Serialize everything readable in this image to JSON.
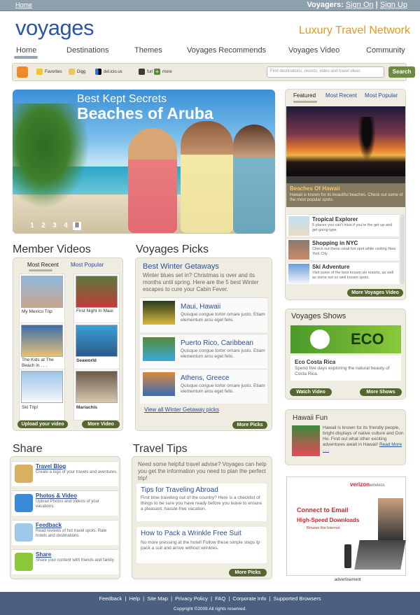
{
  "topbar": {
    "home": "Home",
    "voyagers_label": "Voyagers:",
    "sign_on": "Sign On",
    "sep": " | ",
    "sign_up": "Sign Up"
  },
  "logo": "voyages",
  "tagline": "Luxury Travel Network",
  "nav": [
    "Home",
    "Destinations",
    "Themes",
    "Voyages Recommends",
    "Voyages Video",
    "Community"
  ],
  "toolbar": {
    "items": [
      "Favorites",
      "Digg",
      "del.icio.us",
      "furl",
      "more"
    ],
    "search_placeholder": "Find destinations, resorts, video and travel ideas",
    "search_button": "Search"
  },
  "hero": {
    "line1": "Best Kept Secrets",
    "line2": "Beaches of Aruba",
    "pages": [
      "1",
      "2",
      "3",
      "4",
      "II"
    ]
  },
  "featured": {
    "tabs": [
      "Featured",
      "Most Recent",
      "Most Popular"
    ],
    "title": "Beaches Of Hawaii",
    "desc": "Hawaii is known for its beautiful beaches. Check out some of the most popular spots.",
    "items": [
      {
        "title": "Tropical Explorer",
        "desc": "5 places you can't miss if you're the get up and get going type."
      },
      {
        "title": "Shopping in NYC",
        "desc": "Check out these retail hot spot while visiting New York City."
      },
      {
        "title": "Ski Adventure",
        "desc": "Visit some of the best known ski resorts, as well as some not so well known spots."
      }
    ],
    "button": "More Voyages Video"
  },
  "member_videos": {
    "heading": "Member Videos",
    "tabs": [
      "Most Recent",
      "Most Popular"
    ],
    "videos": [
      "My Mexico Trip",
      "First Night In Maui",
      "The Kids at The Beach in . . .",
      "Seaworld",
      "Ski Trip!",
      "Mariachis"
    ],
    "upload": "Upload your video",
    "more": "More Video"
  },
  "voyages_picks": {
    "heading": "Voyages Picks",
    "title": "Best Winter Getaways",
    "intro": "Winter blues set in? Christmas is over and its months until spring. Here are the 5 best Winter escapes to cure your Cabin Fever.",
    "items": [
      {
        "title": "Maui, Hawaii",
        "desc": "Quisque congue tortor ornare justo. Etiam elementum arcu eget felis."
      },
      {
        "title": "Puerto Rico, Caribbean",
        "desc": "Quisque congue tortor ornare justo. Etiam elementum arcu eget felis."
      },
      {
        "title": "Athens, Greece",
        "desc": "Quisque congue tortor ornare justo. Etiam elementum arcu eget felis."
      }
    ],
    "view_all": "View all Winter Getaway picks",
    "more": "More Picks"
  },
  "shows": {
    "heading": "Voyages Shows",
    "banner": "ECO",
    "title": "Eco Costa Rica",
    "desc": "Spend five days exploring the natural beauty of Costa Rica.",
    "watch": "Watch Video",
    "more": "More Shows"
  },
  "hawaii_fun": {
    "heading": "Hawaii Fun",
    "text": "Hawaii is known for its friendly people, bright displays of native culture and Don Ho. Find out what other exciting adventures await in Hawaii!",
    "read_more": "Read More . . ."
  },
  "share": {
    "heading": "Share",
    "items": [
      {
        "title": "Travel Blog",
        "desc": "Create a logo of your travels and aventures."
      },
      {
        "title": "Photos & Video",
        "desc": "Upload Photos and Videos of your vacations."
      },
      {
        "title": "Feedback",
        "desc": "Read reviews of hot travel spots. Rate hotels and destinations."
      },
      {
        "title": "Share",
        "desc": "Share your content with friends and family."
      }
    ]
  },
  "travel_tips": {
    "heading": "Travel Tips",
    "intro": "Need some helpful travel advise? Voyages can help you get the information you need to plan the perfect trip!",
    "items": [
      {
        "title": "Tips for Traveling Abroad",
        "desc": "First time traveling out of the country? Here is a checklist of things to be sure you have ready before you leave to ensure a pleasant, hassle-free vacation."
      },
      {
        "title": "How to Pack a Wrinkle Free Suit",
        "desc": "No more pressing at the hotel! Follow these simple steps tp pack a suit and arrive without wrinkles."
      }
    ],
    "more": "More Picks"
  },
  "ad": {
    "brand": "verizon",
    "brand2": "wireless",
    "line1": "Connect to Email",
    "line2": "High-Speed Downloads",
    "line3": "Browse the Internet",
    "label": "advertisement"
  },
  "footer": {
    "links": "Feedback  |  Help  |  Site Map  |  Privacy Policy  |  FAQ  |  Corporate Info  |  Supported Browsers",
    "copy": "Copyright ©2008 All rights reserved."
  }
}
